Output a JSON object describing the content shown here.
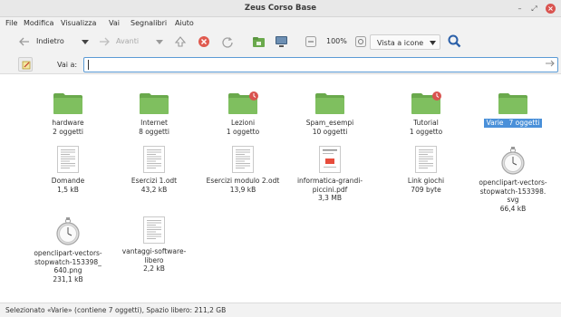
{
  "window": {
    "title": "Zeus Corso Base",
    "controls": [
      "–",
      "⤢",
      "×"
    ]
  },
  "menu": [
    "File",
    "Modifica",
    "Visualizza",
    "Vai",
    "Segnalibri",
    "Aiuto"
  ],
  "toolbar": {
    "back_label": "Indietro",
    "forward_label": "Avanti",
    "zoom": "100%",
    "view_label": "Vista a icone"
  },
  "location": {
    "label": "Vai a:",
    "value": ""
  },
  "files": [
    {
      "name": "hardware",
      "sub": "2 oggetti",
      "type": "folder",
      "emblem": false,
      "selected": false
    },
    {
      "name": "Internet",
      "sub": "8 oggetti",
      "type": "folder",
      "emblem": false,
      "selected": false
    },
    {
      "name": "Lezioni",
      "sub": "1 oggetto",
      "type": "folder",
      "emblem": true,
      "selected": false
    },
    {
      "name": "Spam_esempi",
      "sub": "10 oggetti",
      "type": "folder",
      "emblem": false,
      "selected": false
    },
    {
      "name": "Tutorial",
      "sub": "1 oggetto",
      "type": "folder",
      "emblem": true,
      "selected": false
    },
    {
      "name": "Varie",
      "sub": "7 oggetti",
      "type": "folder",
      "emblem": false,
      "selected": true
    },
    {
      "name": "Domande",
      "sub": "1,5 kB",
      "type": "doc"
    },
    {
      "name": "Esercizi 1.odt",
      "sub": "43,2 kB",
      "type": "doc"
    },
    {
      "name": "Esercizi modulo 2.odt",
      "sub": "13,9 kB",
      "type": "doc"
    },
    {
      "name": "informatica-grandi-\npiccini.pdf",
      "sub": "3,3 MB",
      "type": "pdf"
    },
    {
      "name": "Link giochi",
      "sub": "709 byte",
      "type": "doc"
    },
    {
      "name": "openclipart-vectors-\nstopwatch-153398.\nsvg",
      "sub": "66,4 kB",
      "type": "stopwatch"
    },
    {
      "name": "openclipart-vectors-\nstopwatch-153398_\n640.png",
      "sub": "231,1 kB",
      "type": "stopwatch"
    },
    {
      "name": "vantaggi-software-\nlibero",
      "sub": "2,2 kB",
      "type": "doc"
    }
  ],
  "status": "Selezionato «Varie» (contiene 7 oggetti), Spazio libero: 211,2 GB",
  "colors": {
    "folder": "#7fbf5f",
    "folder_tab": "#6aa94c",
    "selection": "#4a90d9",
    "emblem": "#d9534f"
  }
}
